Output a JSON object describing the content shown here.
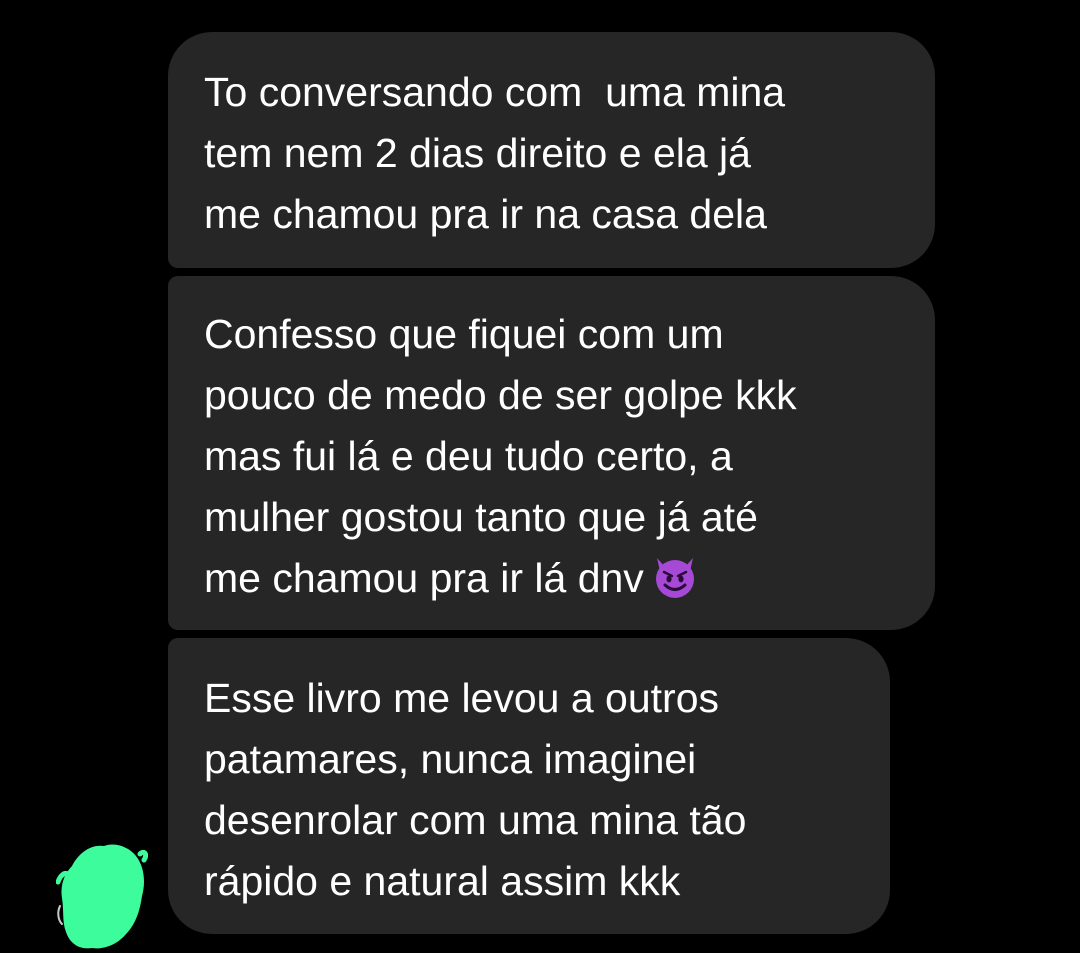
{
  "messages": [
    {
      "lines": [
        "To conversando com  uma mina",
        "tem nem 2 dias direito e ela já",
        "me chamou pra ir na casa dela"
      ]
    },
    {
      "lines": [
        "Confesso que fiquei com um",
        "pouco de medo de ser golpe kkk",
        "mas fui lá e deu tudo certo, a",
        "mulher gostou tanto que já até",
        "me chamou pra ir lá dnv"
      ],
      "emoji": "smiling-devil-icon"
    },
    {
      "lines": [
        "Esse livro me levou a outros",
        "patamares, nunca imaginei",
        "desenrolar com uma mina tão",
        "rápido e natural assim kkk"
      ]
    }
  ],
  "colors": {
    "background": "#000000",
    "bubble": "#262626",
    "text": "#ffffff",
    "avatar_redaction": "#3dfc9c",
    "emoji": "#a64ad6"
  }
}
